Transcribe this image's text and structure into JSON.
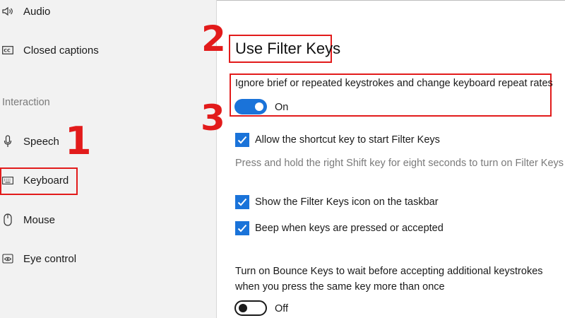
{
  "sidebar": {
    "items": [
      {
        "label": "Audio",
        "icon": "audio-icon"
      },
      {
        "label": "Closed captions",
        "icon": "closed-captions-icon"
      },
      {
        "label": "Speech",
        "icon": "microphone-icon"
      },
      {
        "label": "Keyboard",
        "icon": "keyboard-icon"
      },
      {
        "label": "Mouse",
        "icon": "mouse-icon"
      },
      {
        "label": "Eye control",
        "icon": "eye-icon"
      }
    ],
    "section_label": "Interaction"
  },
  "annotations": {
    "step_1": "1",
    "step_2": "2",
    "step_3": "3",
    "color": "#e21b1b"
  },
  "main": {
    "title": "Use Filter Keys",
    "description": "Ignore brief or repeated keystrokes and change keyboard repeat rates",
    "filter_keys_toggle": {
      "state": "On",
      "on": true
    },
    "checkboxes": [
      {
        "label": "Allow the shortcut key to start Filter Keys",
        "checked": true
      },
      {
        "label": "Show the Filter Keys icon on the taskbar",
        "checked": true
      },
      {
        "label": "Beep when keys are pressed or accepted",
        "checked": true
      }
    ],
    "shortcut_hint": "Press and hold the right Shift key for eight seconds to turn on Filter Keys",
    "bounce_keys": {
      "line_1": "Turn on Bounce Keys to wait before accepting additional keystrokes",
      "line_2": "when you press the same key more than once"
    },
    "bounce_keys_toggle": {
      "state": "Off",
      "on": false
    }
  },
  "colors": {
    "accent": "#1a73d9",
    "sidebar_bg": "#f2f2f2"
  }
}
